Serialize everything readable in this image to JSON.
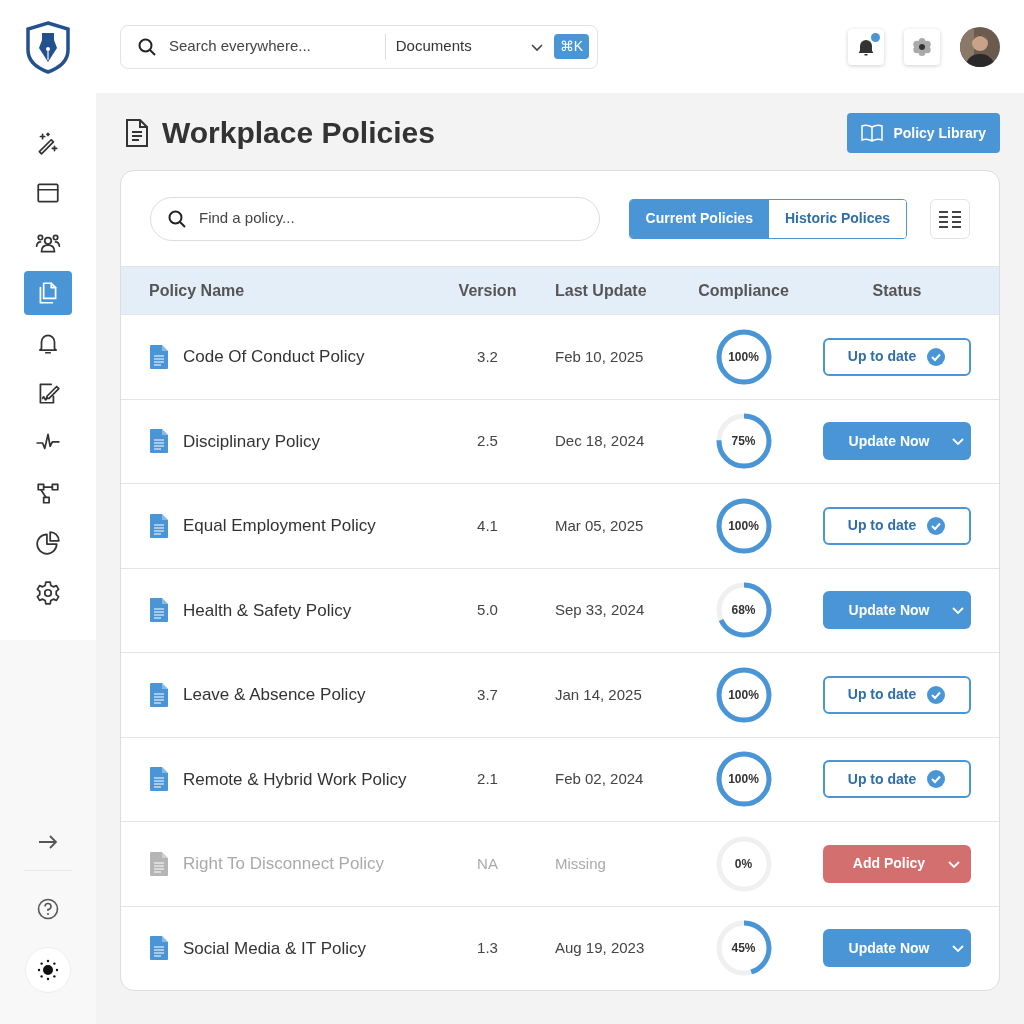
{
  "header": {
    "search": {
      "placeholder": "Search everywhere..."
    },
    "scope": "Documents",
    "shortcut": "⌘K",
    "notifications": {
      "unread": true
    }
  },
  "sidebar": {
    "items": [
      {
        "selected": false
      },
      {
        "selected": false
      },
      {
        "selected": false
      },
      {
        "selected": true
      },
      {
        "selected": false
      },
      {
        "selected": false
      },
      {
        "selected": false
      },
      {
        "selected": false
      },
      {
        "selected": false
      },
      {
        "selected": false
      }
    ]
  },
  "page": {
    "title": "Workplace Policies",
    "library_button": "Policy Library"
  },
  "toolbar": {
    "search": {
      "placeholder": "Find a policy..."
    },
    "tabs": [
      {
        "label": "Current Policies",
        "selected": true
      },
      {
        "label": "Historic Polices",
        "selected": false
      }
    ]
  },
  "table": {
    "columns": [
      "Policy Name",
      "Version",
      "Last Update",
      "Compliance",
      "Status"
    ],
    "rows": [
      {
        "name": "Code Of Conduct Policy",
        "version": "3.2",
        "updated": "Feb 10, 2025",
        "compliance": "100%",
        "level": 1,
        "status": "Up to date",
        "kind": "current",
        "missing": false
      },
      {
        "name": "Disciplinary Policy",
        "version": "2.5",
        "updated": "Dec 18, 2024",
        "compliance": "75%",
        "level": 0.75,
        "status": "Update Now",
        "kind": "update",
        "missing": false
      },
      {
        "name": "Equal Employment Policy",
        "version": "4.1",
        "updated": "Mar 05, 2025",
        "compliance": "100%",
        "level": 1,
        "status": "Up to date",
        "kind": "current",
        "missing": false
      },
      {
        "name": "Health & Safety Policy",
        "version": "5.0",
        "updated": "Sep 33, 2024",
        "compliance": "68%",
        "level": 0.68,
        "status": "Update Now",
        "kind": "update",
        "missing": false
      },
      {
        "name": "Leave & Absence Policy",
        "version": "3.7",
        "updated": "Jan 14, 2025",
        "compliance": "100%",
        "level": 1,
        "status": "Up to date",
        "kind": "current",
        "missing": false
      },
      {
        "name": "Remote & Hybrid Work Policy",
        "version": "2.1",
        "updated": "Feb 02, 2024",
        "compliance": "100%",
        "level": 1,
        "status": "Up to date",
        "kind": "current",
        "missing": false
      },
      {
        "name": "Right To Disconnect Policy",
        "version": "NA",
        "updated": "Missing",
        "compliance": "0%",
        "level": 0,
        "status": "Add Policy",
        "kind": "add",
        "missing": true
      },
      {
        "name": "Social Media & IT Policy",
        "version": "1.3",
        "updated": "Aug 19, 2023",
        "compliance": "45%",
        "level": 0.45,
        "status": "Update Now",
        "kind": "update",
        "missing": false
      }
    ]
  }
}
